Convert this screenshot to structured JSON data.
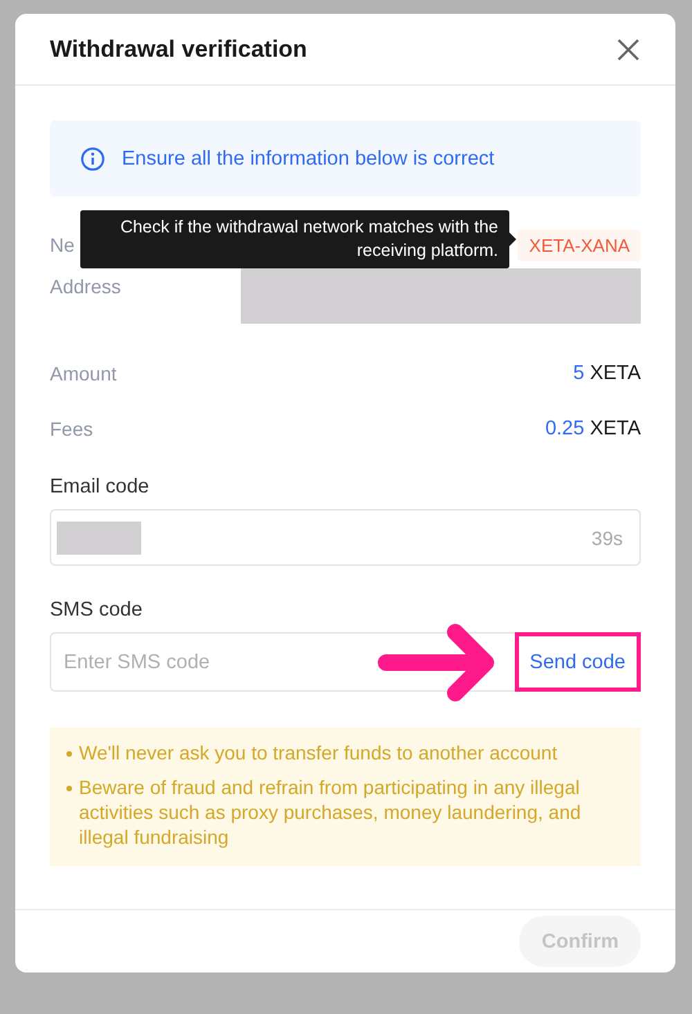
{
  "dialog": {
    "title": "Withdrawal verification"
  },
  "notice": "Ensure all the information below is correct",
  "tooltip": "Check if the withdrawal network matches with the receiving platform.",
  "details": [
    {
      "kind": "tag",
      "label": "Ne",
      "value": "XETA-XANA"
    },
    {
      "kind": "redacted",
      "label": "Address"
    },
    {
      "kind": "amount",
      "label": "Amount",
      "amount": "5",
      "unit": "XETA"
    },
    {
      "kind": "amount",
      "label": "Fees",
      "amount": "0.25",
      "unit": "XETA"
    }
  ],
  "email_code": {
    "label": "Email code",
    "countdown": "39s"
  },
  "sms_code": {
    "label": "SMS code",
    "placeholder": "Enter SMS code",
    "action": "Send code",
    "highlighted": true
  },
  "warnings": [
    "We'll never ask you to transfer funds to another account",
    "Beware of fraud and refrain from participating in any illegal activities such as proxy purchases, money laundering, and illegal fundraising"
  ],
  "confirm": {
    "label": "Confirm",
    "disabled": true
  }
}
